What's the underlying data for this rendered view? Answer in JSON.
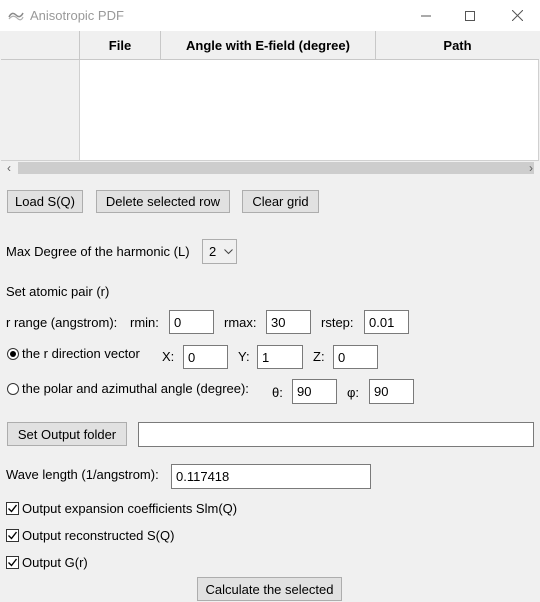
{
  "window": {
    "title": "Anisotropic PDF"
  },
  "grid": {
    "columns": [
      "File",
      "Angle with E-field (degree)",
      "Path"
    ]
  },
  "toolbar": {
    "load": "Load S(Q)",
    "delete": "Delete selected row",
    "clear": "Clear grid"
  },
  "harmonic": {
    "label": "Max Degree of the harmonic (L)",
    "value": "2"
  },
  "atomic_pair": {
    "heading": "Set atomic pair (r)"
  },
  "r_range": {
    "label": "r range (angstrom):",
    "rmin_label": "rmin:",
    "rmin": "0",
    "rmax_label": "rmax:",
    "rmax": "30",
    "rstep_label": "rstep:",
    "rstep": "0.01"
  },
  "direction": {
    "label": "the r direction vector",
    "x_label": "X:",
    "x": "0",
    "y_label": "Y:",
    "y": "1",
    "z_label": "Z:",
    "z": "0",
    "selected": true
  },
  "angles": {
    "label": "the polar and azimuthal angle (degree):",
    "theta_label": "θ:",
    "theta": "90",
    "phi_label": "φ:",
    "phi": "90",
    "selected": false
  },
  "output": {
    "button": "Set Output folder",
    "path": ""
  },
  "wavelength": {
    "label": "Wave length (1/angstrom):",
    "value": "0.117418"
  },
  "options": [
    {
      "label": "Output expansion coefficients Slm(Q)",
      "checked": true
    },
    {
      "label": "Output reconstructed S(Q)",
      "checked": true
    },
    {
      "label": "Output G(r)",
      "checked": true
    }
  ],
  "calculate": "Calculate the selected",
  "colors": {
    "titlebar": "#ffffff",
    "window_bg": "#f0f0f0",
    "button_bg": "#e1e1e1"
  }
}
